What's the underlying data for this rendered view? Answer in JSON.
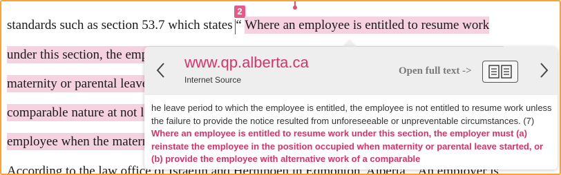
{
  "document": {
    "line1_prefix": "standards such as section 53.7 which states “ ",
    "line1_highlight": "Where an employee is entitled to resume work",
    "line2": "under this section, the employer must (a) reinstate the employee in the position occupied when",
    "line3": "maternity or parental leave started, or (b) provide the employee with alternative work of a",
    "line4": "comparable nature at not less than the earnings and other benefits that had accrued to the",
    "line5": "employee when the maternity or parental leave started.”",
    "line6": "According to the law office of Israelin and Hernihoen in Edmonton, Alberta, “An employer is",
    "badge": "2"
  },
  "popup": {
    "source_url": "www.qp.alberta.ca",
    "source_type": "Internet Source",
    "open_full_text": "Open full text ->",
    "body_plain": "he leave period to which the employee is entitled, the employee is not entitled to resume work unless the failure to provide the notice resulted from unforeseeable or unpreventable circumstances. (7) ",
    "body_match": "Where an employee is entitled to resume work under this section, the employer must (a) reinstate the employee in the position occupied when maternity or parental leave started, or (b) provide the employee with alternative work of a comparable"
  },
  "colors": {
    "accent": "#d6336c",
    "highlight": "#f6d2e0",
    "frame": "#f5a43c"
  },
  "icons": [
    "prev-chevron-icon",
    "next-chevron-icon",
    "compare-view-icon"
  ]
}
